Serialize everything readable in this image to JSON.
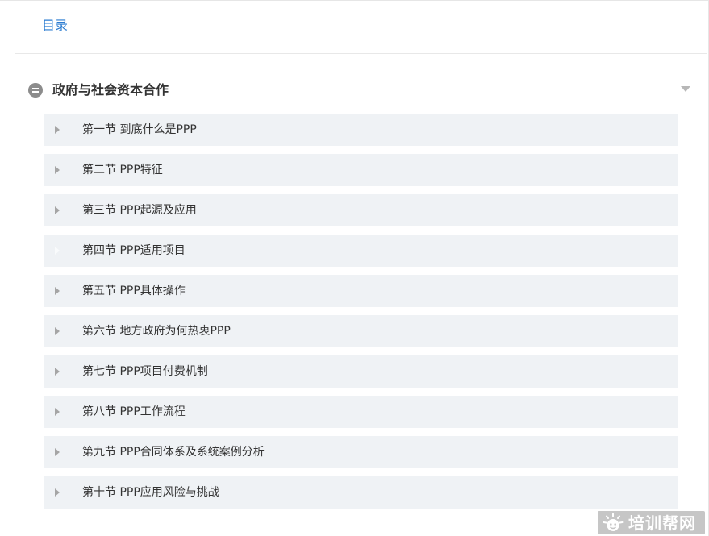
{
  "toc": {
    "title": "目录"
  },
  "chapter": {
    "title": "政府与社会资本合作",
    "expanded": true
  },
  "sections": [
    {
      "label": "第一节 到底什么是PPP"
    },
    {
      "label": "第二节 PPP特征"
    },
    {
      "label": "第三节 PPP起源及应用"
    },
    {
      "label": "第四节 PPP适用项目",
      "faint_arrow": true
    },
    {
      "label": "第五节 PPP具体操作"
    },
    {
      "label": "第六节 地方政府为何热衷PPP"
    },
    {
      "label": "第七节 PPP项目付费机制"
    },
    {
      "label": "第八节 PPP工作流程"
    },
    {
      "label": "第九节 PPP合同体系及系统案例分析"
    },
    {
      "label": "第十节 PPP应用风险与挑战"
    }
  ],
  "watermark": {
    "text": "培训帮网",
    "logo_icon": "sun-face-icon"
  },
  "colors": {
    "accent": "#2a7bd1",
    "row_background": "#eff2f5",
    "text": "#333333"
  }
}
